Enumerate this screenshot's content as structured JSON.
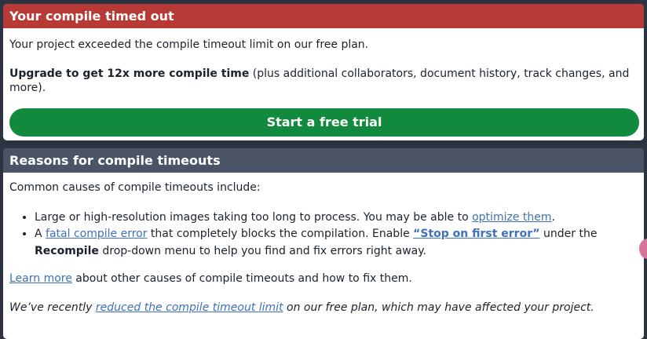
{
  "timeout_card": {
    "title": "Your compile timed out",
    "message": "Your project exceeded the compile timeout limit on our free plan.",
    "upgrade_bold": "Upgrade to get 12x more compile time",
    "upgrade_rest": " (plus additional collaborators, document history, track changes, and more).",
    "trial_button": "Start a free trial"
  },
  "reasons_card": {
    "title": "Reasons for compile timeouts",
    "intro": "Common causes of compile timeouts include:",
    "item1": {
      "text_before": "Large or high-resolution images taking too long to process. You may be able to ",
      "link": "optimize them",
      "text_after": "."
    },
    "item2": {
      "text_a": "A ",
      "link_fatal": "fatal compile error",
      "text_b": " that completely blocks the compilation. Enable ",
      "link_stop": "“Stop on first error”",
      "text_c": " under the ",
      "recompile": "Recompile",
      "text_d": " drop-down menu to help you find and fix errors right away."
    },
    "learn_link": "Learn more",
    "learn_rest": " about other causes of compile timeouts and how to fix them.",
    "recent_before": "We’ve recently ",
    "recent_link": "reduced the compile timeout limit",
    "recent_after": " on our free plan, which may have affected your project."
  },
  "colors": {
    "header_red": "#b83a36",
    "header_slate": "#4b5366",
    "button_green": "#128a3e",
    "link_blue": "#3e70bb"
  }
}
